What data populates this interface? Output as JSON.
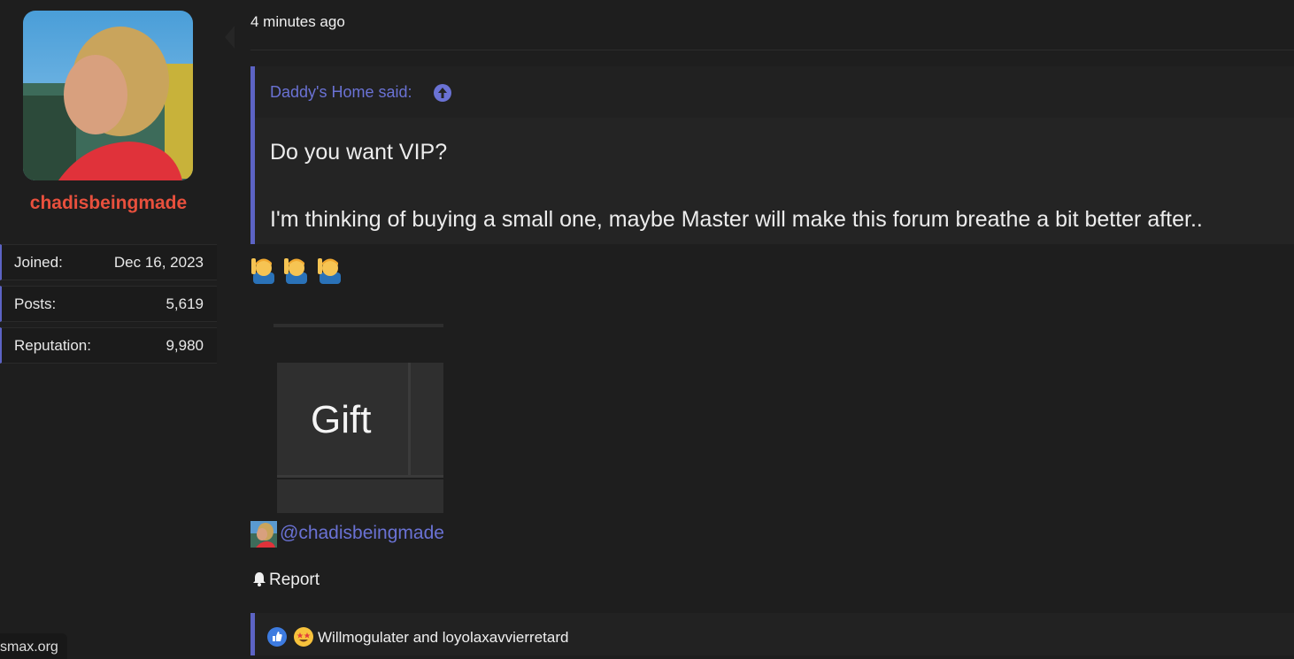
{
  "user": {
    "username": "chadisbeingmade",
    "stats": [
      {
        "label": "Joined:",
        "value": "Dec 16, 2023"
      },
      {
        "label": "Posts:",
        "value": "5,619"
      },
      {
        "label": "Reputation:",
        "value": "9,980"
      }
    ]
  },
  "post": {
    "timestamp": "4 minutes ago",
    "quote": {
      "author": "Daddy's Home said:",
      "lines": [
        "Do you want VIP?",
        "I'm thinking of buying a small one, maybe Master will make this forum breathe a bit better after.."
      ]
    },
    "emoji_count": 3,
    "gift_label": "Gift",
    "mention": "@chadisbeingmade",
    "report_label": "Report",
    "reactions_text": "Willmogulater and loyolaxavvierretard"
  },
  "status_bar": {
    "site": "ksmax.org"
  }
}
